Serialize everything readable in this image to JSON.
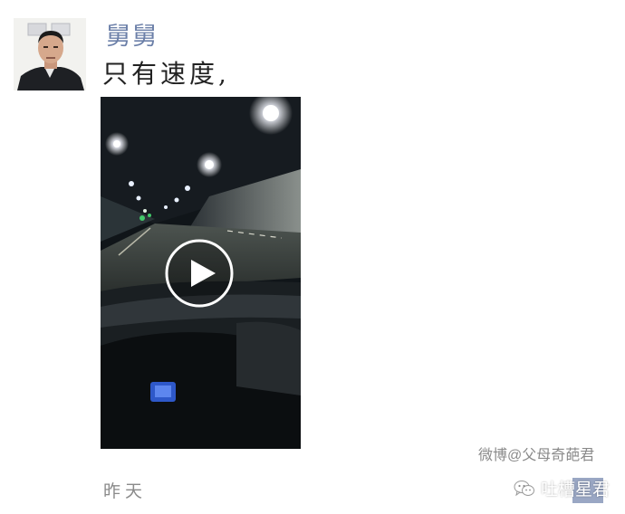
{
  "post": {
    "username": "舅舅",
    "text": "只有速度,",
    "timestamp": "昨天"
  },
  "video": {
    "play_icon": "play-icon"
  },
  "watermark": {
    "weibo": "微博@父母奇葩君",
    "source_name": "吐槽星君",
    "source_icon": "wechat-logo-icon"
  },
  "colors": {
    "username": "#6b7fa8",
    "comment_button": "#9aa7c4",
    "muted_text": "#8a8a8a"
  }
}
